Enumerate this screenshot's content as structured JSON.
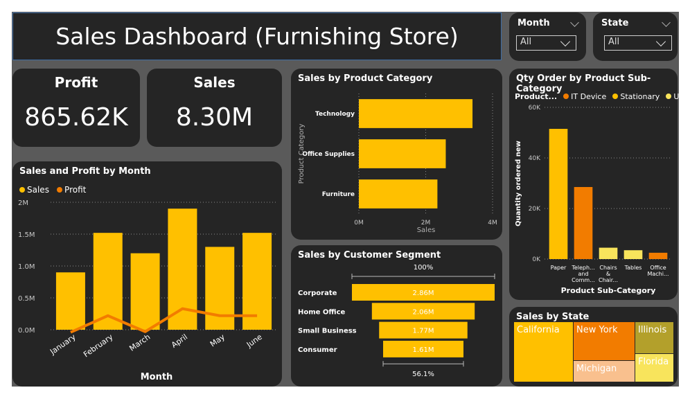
{
  "header": {
    "title": "Sales Dashboard (Furnishing Store)"
  },
  "slicers": {
    "month": {
      "label": "Month",
      "value": "All"
    },
    "state": {
      "label": "State",
      "value": "All"
    }
  },
  "kpis": {
    "profit": {
      "label": "Profit",
      "value": "865.62K"
    },
    "sales": {
      "label": "Sales",
      "value": "8.30M"
    }
  },
  "colors": {
    "sales": "#ffc000",
    "profit": "#f27c00",
    "stationary": "#ffc000",
    "it_device": "#f27c00",
    "utensils": "#f8e45c",
    "card": "#252525",
    "background": "#5a5a5a"
  },
  "chart_data": [
    {
      "id": "sales_profit_by_month",
      "type": "bar",
      "title": "Sales and Profit by Month",
      "xlabel": "Month",
      "ylabel": "",
      "categories": [
        "January",
        "February",
        "March",
        "April",
        "May",
        "June"
      ],
      "ylim": [
        0,
        2000000
      ],
      "yticks": [
        "0.0M",
        "0.5M",
        "1.0M",
        "1.5M",
        "2M"
      ],
      "grid": true,
      "legend_position": "top-left",
      "series": [
        {
          "name": "Sales",
          "type": "bar",
          "values": [
            900000,
            1520000,
            1200000,
            1900000,
            1300000,
            1520000
          ]
        },
        {
          "name": "Profit",
          "type": "line",
          "values": [
            -40000,
            220000,
            -30000,
            330000,
            220000,
            220000
          ]
        }
      ]
    },
    {
      "id": "sales_by_product_category",
      "type": "bar",
      "orientation": "horizontal",
      "title": "Sales by Product Category",
      "xlabel": "Sales",
      "ylabel": "Product Category",
      "categories": [
        "Technology",
        "Office Supplies",
        "Furniture"
      ],
      "values": [
        3400000,
        2600000,
        2350000
      ],
      "xlim": [
        0,
        4000000
      ],
      "xticks": [
        "0M",
        "2M",
        "4M"
      ],
      "grid": true
    },
    {
      "id": "sales_by_customer_segment",
      "type": "bar",
      "subtype": "funnel",
      "title": "Sales by Customer Segment",
      "categories": [
        "Corporate",
        "Home Office",
        "Small Business",
        "Consumer"
      ],
      "values": [
        2860000,
        2060000,
        1770000,
        1610000
      ],
      "value_labels": [
        "2.86M",
        "2.06M",
        "1.77M",
        "1.61M"
      ],
      "top_percent": "100%",
      "bottom_percent": "56.1%"
    },
    {
      "id": "qty_order_by_sub_category",
      "type": "bar",
      "title": "Qty Order by Product Sub-Category",
      "xlabel": "Product Sub-Category",
      "ylabel": "Quantity ordered new",
      "legend_title": "Product...",
      "legend": [
        "IT Device",
        "Stationary",
        "Utensils"
      ],
      "legend_position": "top-left",
      "categories": [
        "Paper",
        "Teleph... and Comm...",
        "Chairs & Chair...",
        "Tables",
        "Office Machi..."
      ],
      "category_lines": [
        [
          "Paper"
        ],
        [
          "Teleph...",
          "and",
          "Comm..."
        ],
        [
          "Chairs",
          "&",
          "Chair..."
        ],
        [
          "Tables"
        ],
        [
          "Office",
          "Machi..."
        ]
      ],
      "values": [
        51500,
        28500,
        4500,
        3500,
        2500
      ],
      "series_of": [
        "Stationary",
        "IT Device",
        "Utensils",
        "Utensils",
        "IT Device"
      ],
      "ylim": [
        0,
        60000
      ],
      "yticks": [
        "0K",
        "20K",
        "40K",
        "60K"
      ],
      "grid": true
    },
    {
      "id": "sales_by_state",
      "type": "heatmap",
      "subtype": "treemap",
      "title": "Sales by State",
      "categories": [
        "California",
        "New York",
        "Michigan",
        "Illinois",
        "Florida"
      ]
    }
  ]
}
